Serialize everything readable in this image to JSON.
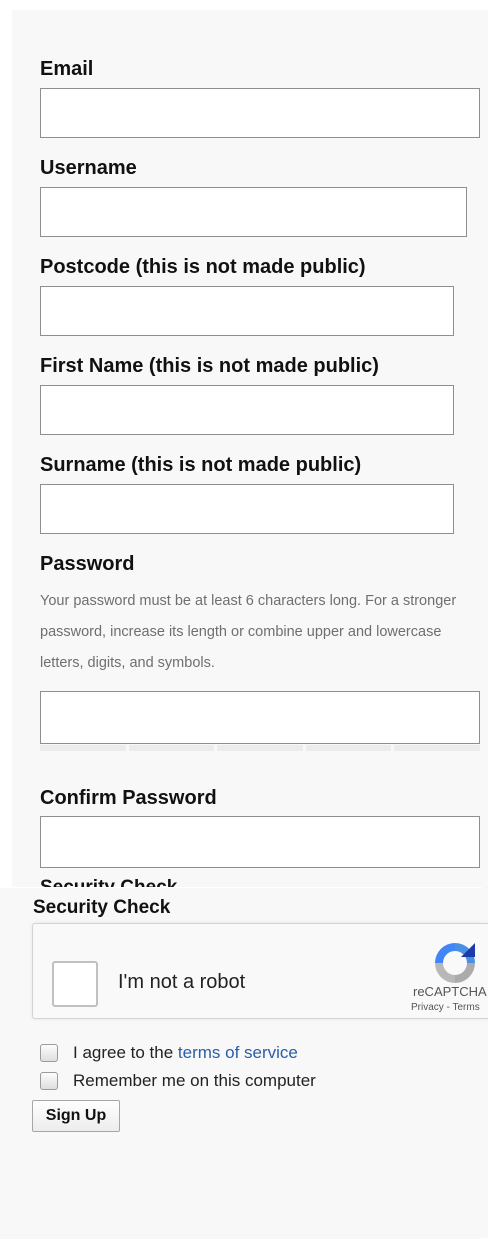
{
  "form": {
    "email": {
      "label": "Email",
      "value": ""
    },
    "username": {
      "label": "Username",
      "value": ""
    },
    "postcode": {
      "label": "Postcode (this is not made public)",
      "value": ""
    },
    "first_name": {
      "label": "First Name (this is not made public)",
      "value": ""
    },
    "surname": {
      "label": "Surname (this is not made public)",
      "value": ""
    },
    "password": {
      "label": "Password",
      "hint": "Your password must be at least 6 characters long. For a stronger password, increase its length or combine upper and lowercase letters, digits, and symbols.",
      "value": "",
      "strength_segments": 5
    },
    "confirm_password": {
      "label": "Confirm Password",
      "value": ""
    }
  },
  "security": {
    "title": "Security Check",
    "recaptcha": {
      "checkbox_label": "I'm not a robot",
      "brand": "reCAPTCHA",
      "links": "Privacy - Terms",
      "icon": "recaptcha-logo-icon"
    }
  },
  "agreements": {
    "terms_prefix": "I agree to the ",
    "terms_link": "terms of service",
    "remember": "Remember me on this computer"
  },
  "actions": {
    "signup_label": "Sign Up"
  },
  "colors": {
    "link": "#2a5ea8",
    "panel_bg": "#f8f8f8",
    "border": "#8e8e8e"
  }
}
